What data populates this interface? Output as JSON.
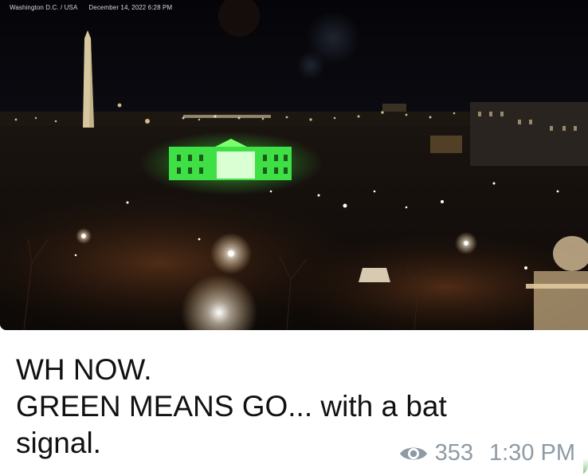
{
  "photo": {
    "location_label": "Washington D.C. / USA",
    "timestamp_label": "December 14, 2022 6:28 PM",
    "accent_green": "#39ff5c"
  },
  "message": {
    "lines": [
      "WH NOW.",
      "GREEN MEANS GO... with a bat",
      "signal."
    ]
  },
  "meta": {
    "views_icon": "eye-icon",
    "views": "353",
    "time": "1:30 PM"
  }
}
